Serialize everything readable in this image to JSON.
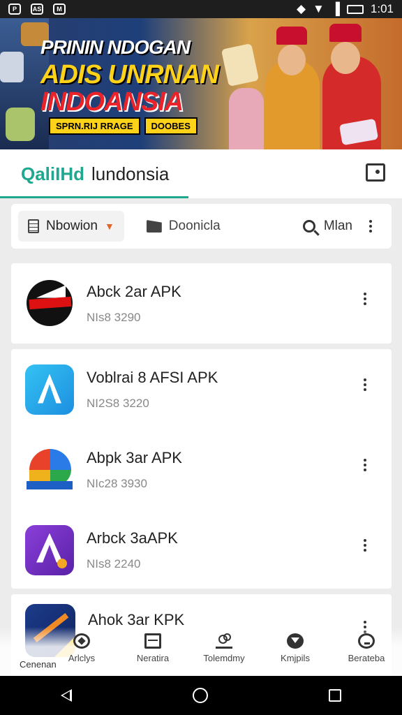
{
  "status_bar": {
    "left_icons": [
      "P",
      "AS",
      "M"
    ],
    "time": "1:01",
    "icons": [
      "shield-icon",
      "wifi-icon",
      "signal-icon",
      "battery-icon"
    ]
  },
  "banner": {
    "line1": "PRININ NDOGAN",
    "line2": "ADIS UNRNAN",
    "line3": "INDOANSIA",
    "strip_text": "SPRN.RIJ RRAGE",
    "strip_badge": "DOOBES"
  },
  "header": {
    "brand_accent": "QaliIHd",
    "brand_name": "lundonsia",
    "accent_color": "#1fa88f"
  },
  "filters": {
    "chip1_label": "Nbowion",
    "chip2_label": "Doonicla",
    "search_label": "Mlan"
  },
  "apps": [
    {
      "title": "Abck 2ar APK",
      "subtitle": "NIs8 3290",
      "icon": "red-swoosh-logo-icon"
    },
    {
      "title": "Voblrai 8 AFSI APK",
      "subtitle": "NI2S8 3220",
      "icon": "blue-a-logo-icon"
    },
    {
      "title": "Abpk 3ar APK",
      "subtitle": "NIc28 3930",
      "icon": "multicolor-logo-icon"
    },
    {
      "title": "Arbck 3aAPK",
      "subtitle": "NIs8 2240",
      "icon": "purple-a-logo-icon"
    },
    {
      "title": "Ahok 3ar KPK",
      "subtitle": "",
      "icon": "navy-logo-icon"
    }
  ],
  "bottom_nav": {
    "first_tab": "Cenenan",
    "items": [
      {
        "label": "Arlclys",
        "icon": "compass-icon"
      },
      {
        "label": "Neratira",
        "icon": "box-icon"
      },
      {
        "label": "Tolemdmy",
        "icon": "people-icon"
      },
      {
        "label": "Kmjpils",
        "icon": "shield-icon"
      },
      {
        "label": "Berateba",
        "icon": "bubble-icon"
      }
    ]
  }
}
